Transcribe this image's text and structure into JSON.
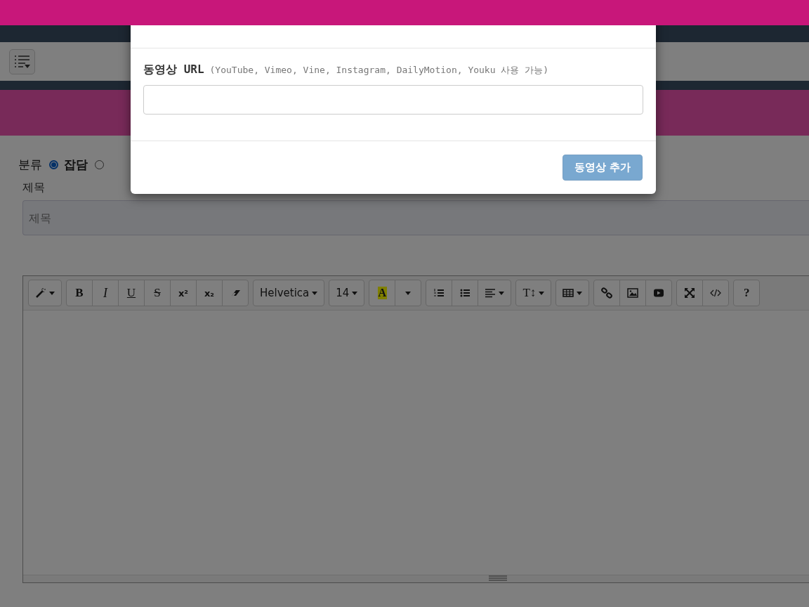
{
  "category": {
    "label": "분류",
    "options": [
      {
        "label": "잡담",
        "selected": true
      },
      {
        "selected": false
      }
    ]
  },
  "title_field": {
    "label": "제목",
    "placeholder": "제목"
  },
  "editor": {
    "toolbar": [
      {
        "buttons": [
          {
            "kind": "icon"
          }
        ]
      },
      {
        "buttons": [
          {
            "kind": "text",
            "label": "B"
          },
          {
            "kind": "text",
            "label": "I"
          },
          {
            "kind": "text",
            "label": "U"
          },
          {
            "kind": "text",
            "label": "S"
          },
          {
            "kind": "text",
            "label": "x²"
          },
          {
            "kind": "text",
            "label": "x₂"
          },
          {
            "kind": "icon"
          }
        ]
      },
      {
        "buttons": [
          {
            "kind": "text",
            "label": "Helvetica"
          }
        ]
      },
      {
        "buttons": [
          {
            "kind": "text",
            "label": "14"
          }
        ]
      },
      {
        "buttons": [
          {
            "kind": "color",
            "label": "A"
          },
          {
            "kind": "icon"
          }
        ]
      },
      {
        "buttons": [
          {
            "kind": "icon"
          },
          {
            "kind": "icon"
          },
          {
            "kind": "icon"
          }
        ]
      },
      {
        "buttons": [
          {
            "kind": "text",
            "label": "T↕"
          }
        ]
      },
      {
        "buttons": [
          {
            "kind": "icon"
          }
        ]
      },
      {
        "buttons": [
          {
            "kind": "icon"
          },
          {
            "kind": "icon"
          },
          {
            "kind": "icon"
          }
        ]
      },
      {
        "buttons": [
          {
            "kind": "icon"
          },
          {
            "kind": "icon"
          }
        ]
      },
      {
        "buttons": [
          {
            "kind": "text",
            "label": "?"
          }
        ]
      }
    ]
  },
  "modal": {
    "field_label": "동영상 URL",
    "field_hint": "(YouTube, Vimeo, Vine, Instagram, DailyMotion, Youku 사용 가능)",
    "submit": {
      "label": "동영상 추가",
      "disabled": true
    }
  }
}
